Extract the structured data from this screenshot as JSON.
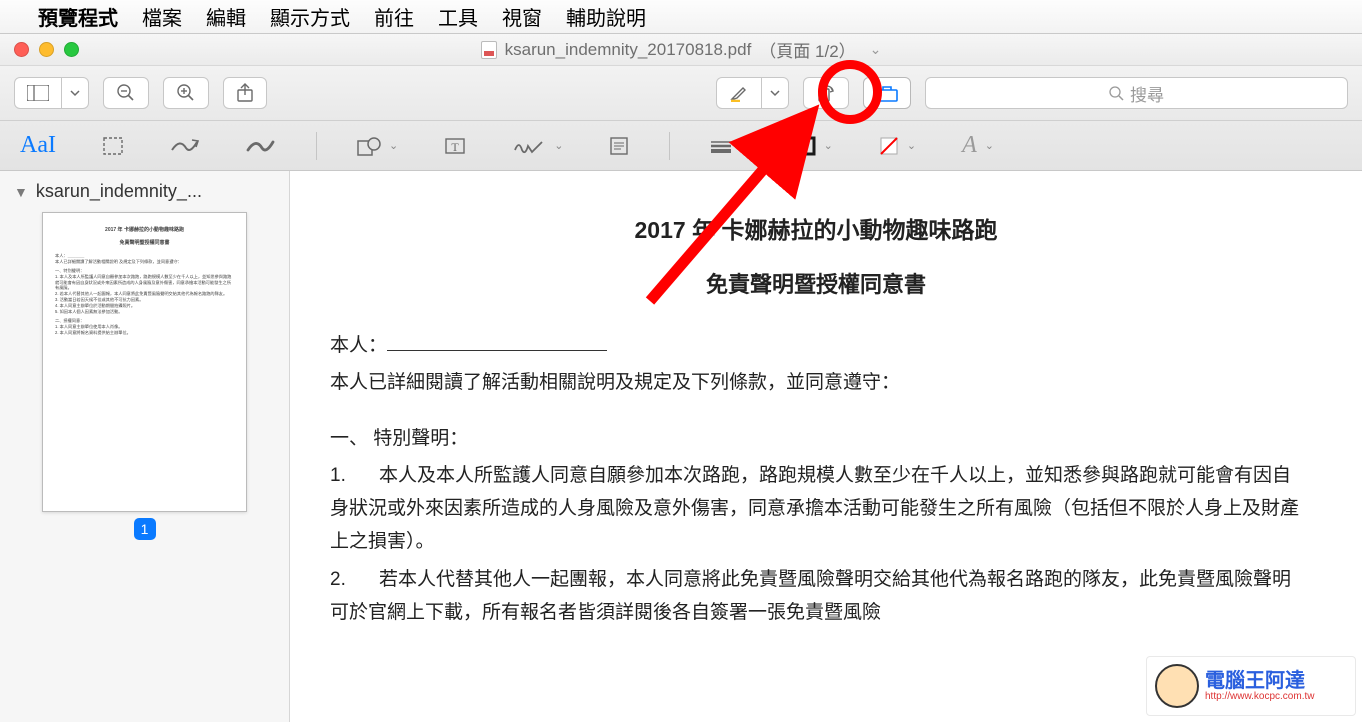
{
  "menubar": {
    "app_name": "預覽程式",
    "items": [
      "檔案",
      "編輯",
      "顯示方式",
      "前往",
      "工具",
      "視窗",
      "輔助說明"
    ]
  },
  "titlebar": {
    "filename": "ksarun_indemnity_20170818.pdf",
    "page_info": "（頁面 1/2）"
  },
  "toolbar": {
    "search_placeholder": "搜尋"
  },
  "markup": {
    "text_tool": "AaI"
  },
  "sidebar": {
    "filename_truncated": "ksarun_indemnity_...",
    "page_label": "1"
  },
  "document": {
    "title": "2017 年  卡娜赫拉的小動物趣味路跑",
    "subtitle": "免責聲明暨授權同意書",
    "line_person": "本人：",
    "line_intro": "本人已詳細閱讀了解活動相關說明及規定及下列條款，並同意遵守：",
    "section1_title": "一、 特別聲明：",
    "item1_label": "1.",
    "item1_text": "本人及本人所監護人同意自願參加本次路跑，路跑規模人數至少在千人以上，並知悉參與路跑就可能會有因自身狀況或外來因素所造成的人身風險及意外傷害，同意承擔本活動可能發生之所有風險（包括但不限於人身上及財產上之損害）。",
    "item2_label": "2.",
    "item2_text": "若本人代替其他人一起團報，本人同意將此免責暨風險聲明交給其他代為報名路跑的隊友，此免責暨風險聲明可於官網上下載，所有報名者皆須詳閱後各自簽署一張免責暨風險"
  },
  "watermark": {
    "brand": "電腦王阿達",
    "url": "http://www.kocpc.com.tw"
  }
}
